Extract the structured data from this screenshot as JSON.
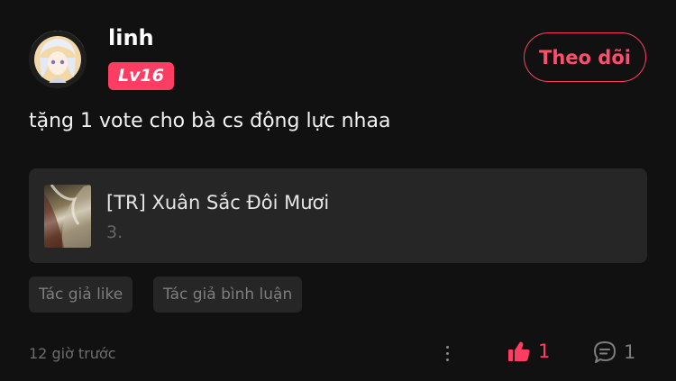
{
  "user": {
    "name": "linh",
    "level": "Lv16",
    "follow_label": "Theo dõi"
  },
  "comment": {
    "text": "tặng 1 vote cho bà cs động lực nhaa"
  },
  "story": {
    "title": "[TR] Xuân Sắc Đôi Mươi",
    "chapter": "3."
  },
  "tags": [
    "Tác giả like",
    "Tác giả bình luận"
  ],
  "footer": {
    "timestamp": "12 giờ trước",
    "like_count": "1",
    "reply_count": "1"
  },
  "colors": {
    "accent": "#ff3d63",
    "background": "#111111",
    "card": "#262626"
  },
  "icons": {
    "like": "thumbs-up-icon",
    "reply": "chat-bubble-icon",
    "more": "more-vertical-icon"
  }
}
